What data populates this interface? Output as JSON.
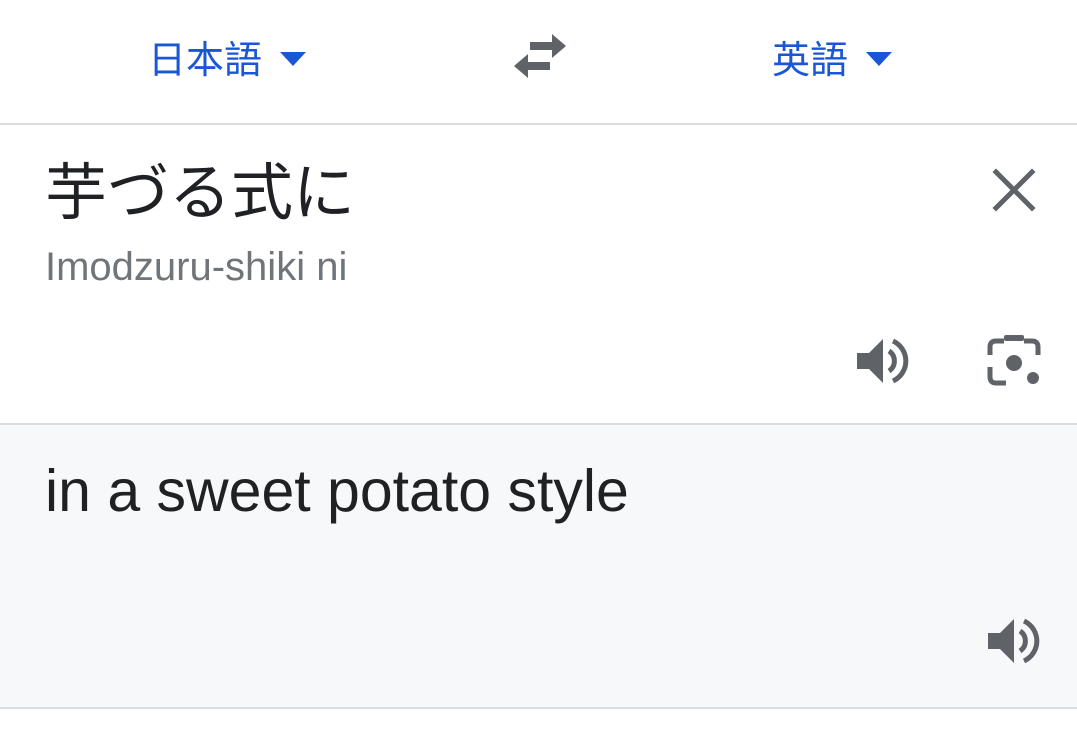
{
  "language_bar": {
    "source_language": "日本語",
    "target_language": "英語",
    "swap_icon": "swap-arrows-icon",
    "dropdown_icon": "caret-down-icon"
  },
  "source": {
    "text": "芋づる式に",
    "romanization": "Imodzuru-shiki ni",
    "clear_icon": "close-icon",
    "speaker_icon": "speaker-icon",
    "camera_icon": "camera-lens-icon"
  },
  "output": {
    "text": "in a sweet potato style",
    "speaker_icon": "speaker-icon"
  },
  "colors": {
    "accent": "#1a56d6",
    "icon_gray": "#5f6368",
    "divider": "#dadce0",
    "output_bg": "#f7f8fa",
    "text_primary": "#202124",
    "text_secondary": "#70757a"
  }
}
